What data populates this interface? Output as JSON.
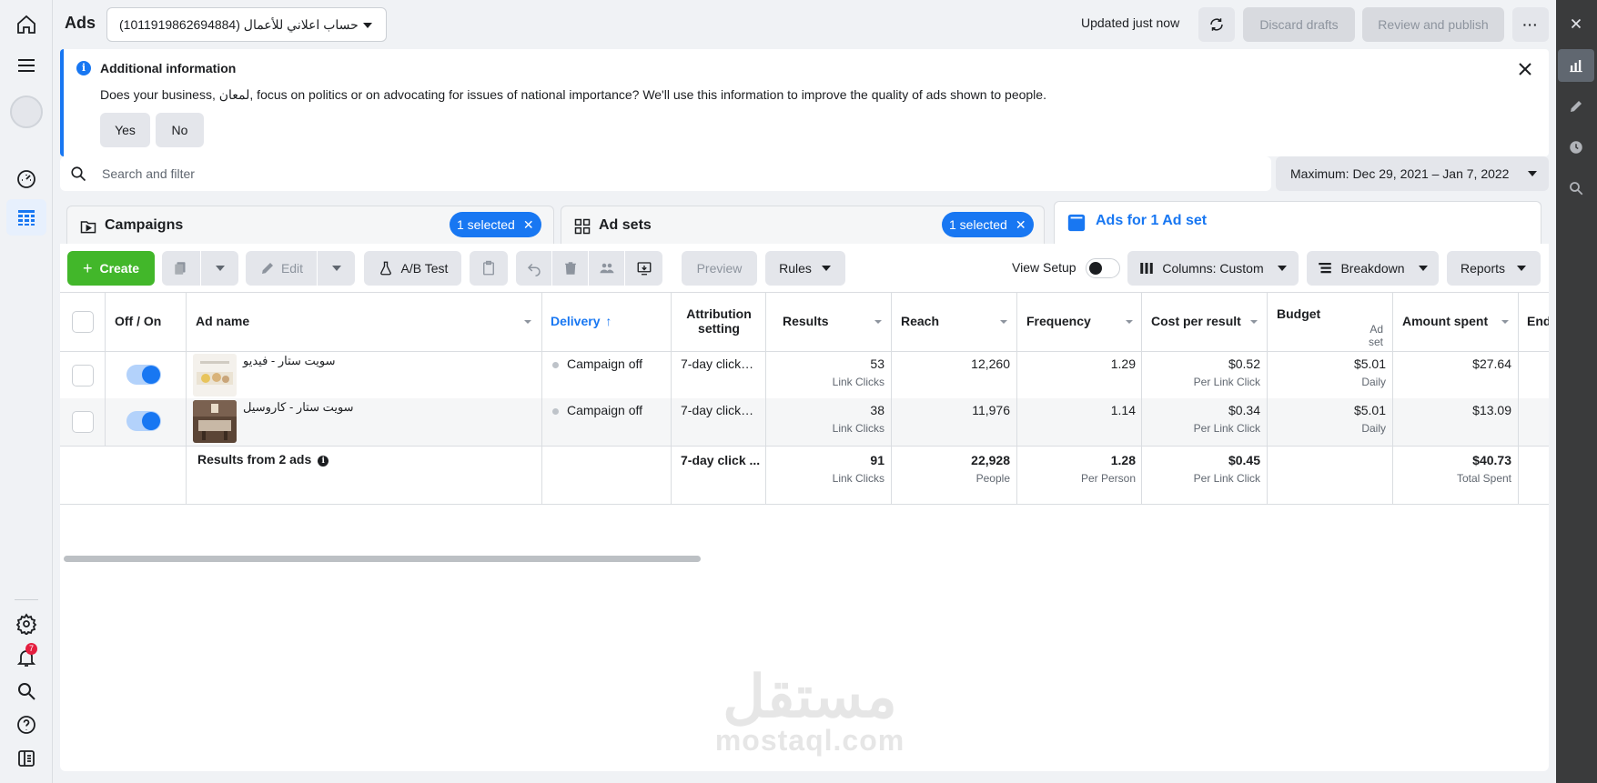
{
  "app": {
    "title": "Ads"
  },
  "account": {
    "name": "حساب اعلاني للأعمال (1011919862694884)"
  },
  "header": {
    "status": "Updated just now",
    "discard_label": "Discard drafts",
    "review_label": "Review and publish"
  },
  "banner": {
    "title": "Additional information",
    "text": "Does your business, لمعان, focus on politics or on advocating for issues of national importance? We'll use this information to improve the quality of ads shown to people.",
    "yes": "Yes",
    "no": "No"
  },
  "search": {
    "placeholder": "Search and filter"
  },
  "date_range": "Maximum: Dec 29, 2021 – Jan 7, 2022",
  "tabs": {
    "campaigns": {
      "label": "Campaigns",
      "selected": "1 selected"
    },
    "adsets": {
      "label": "Ad sets",
      "selected": "1 selected"
    },
    "ads": {
      "label": "Ads for 1 Ad set"
    }
  },
  "toolbar": {
    "create": "Create",
    "edit": "Edit",
    "abtest": "A/B Test",
    "preview": "Preview",
    "rules": "Rules",
    "view_setup": "View Setup",
    "columns": "Columns: Custom",
    "breakdown": "Breakdown",
    "reports": "Reports"
  },
  "table": {
    "headers": {
      "offon": "Off / On",
      "adname": "Ad name",
      "delivery": "Delivery",
      "attribution": "Attribution setting",
      "results": "Results",
      "reach": "Reach",
      "frequency": "Frequency",
      "cpr": "Cost per result",
      "budget": "Budget",
      "budget_sub": "Ad set",
      "spent": "Amount spent",
      "end": "End"
    },
    "rows": [
      {
        "name": "سويت ستار - فيديو",
        "delivery": "Campaign off",
        "attribution": "7-day click…",
        "results": "53",
        "results_sub": "Link Clicks",
        "reach": "12,260",
        "frequency": "1.29",
        "cpr": "$0.52",
        "cpr_sub": "Per Link Click",
        "budget": "$5.01",
        "budget_sub": "Daily",
        "spent": "$27.64",
        "on": true
      },
      {
        "name": "سويت ستار - كاروسيل",
        "delivery": "Campaign off",
        "attribution": "7-day click…",
        "results": "38",
        "results_sub": "Link Clicks",
        "reach": "11,976",
        "frequency": "1.14",
        "cpr": "$0.34",
        "cpr_sub": "Per Link Click",
        "budget": "$5.01",
        "budget_sub": "Daily",
        "spent": "$13.09",
        "on": true
      }
    ],
    "summary": {
      "label": "Results from 2 ads",
      "attribution": "7-day click ...",
      "results": "91",
      "results_sub": "Link Clicks",
      "reach": "22,928",
      "reach_sub": "People",
      "frequency": "1.28",
      "frequency_sub": "Per Person",
      "cpr": "$0.45",
      "cpr_sub": "Per Link Click",
      "spent": "$40.73",
      "spent_sub": "Total Spent"
    }
  },
  "watermark": {
    "arabic": "مستقل",
    "latin": "mostaql.com"
  },
  "notifications": {
    "count": "7"
  },
  "colors": {
    "accent": "#1877f2",
    "create_green": "#42b72a",
    "sidebar_dark": "#3a3b3c"
  }
}
